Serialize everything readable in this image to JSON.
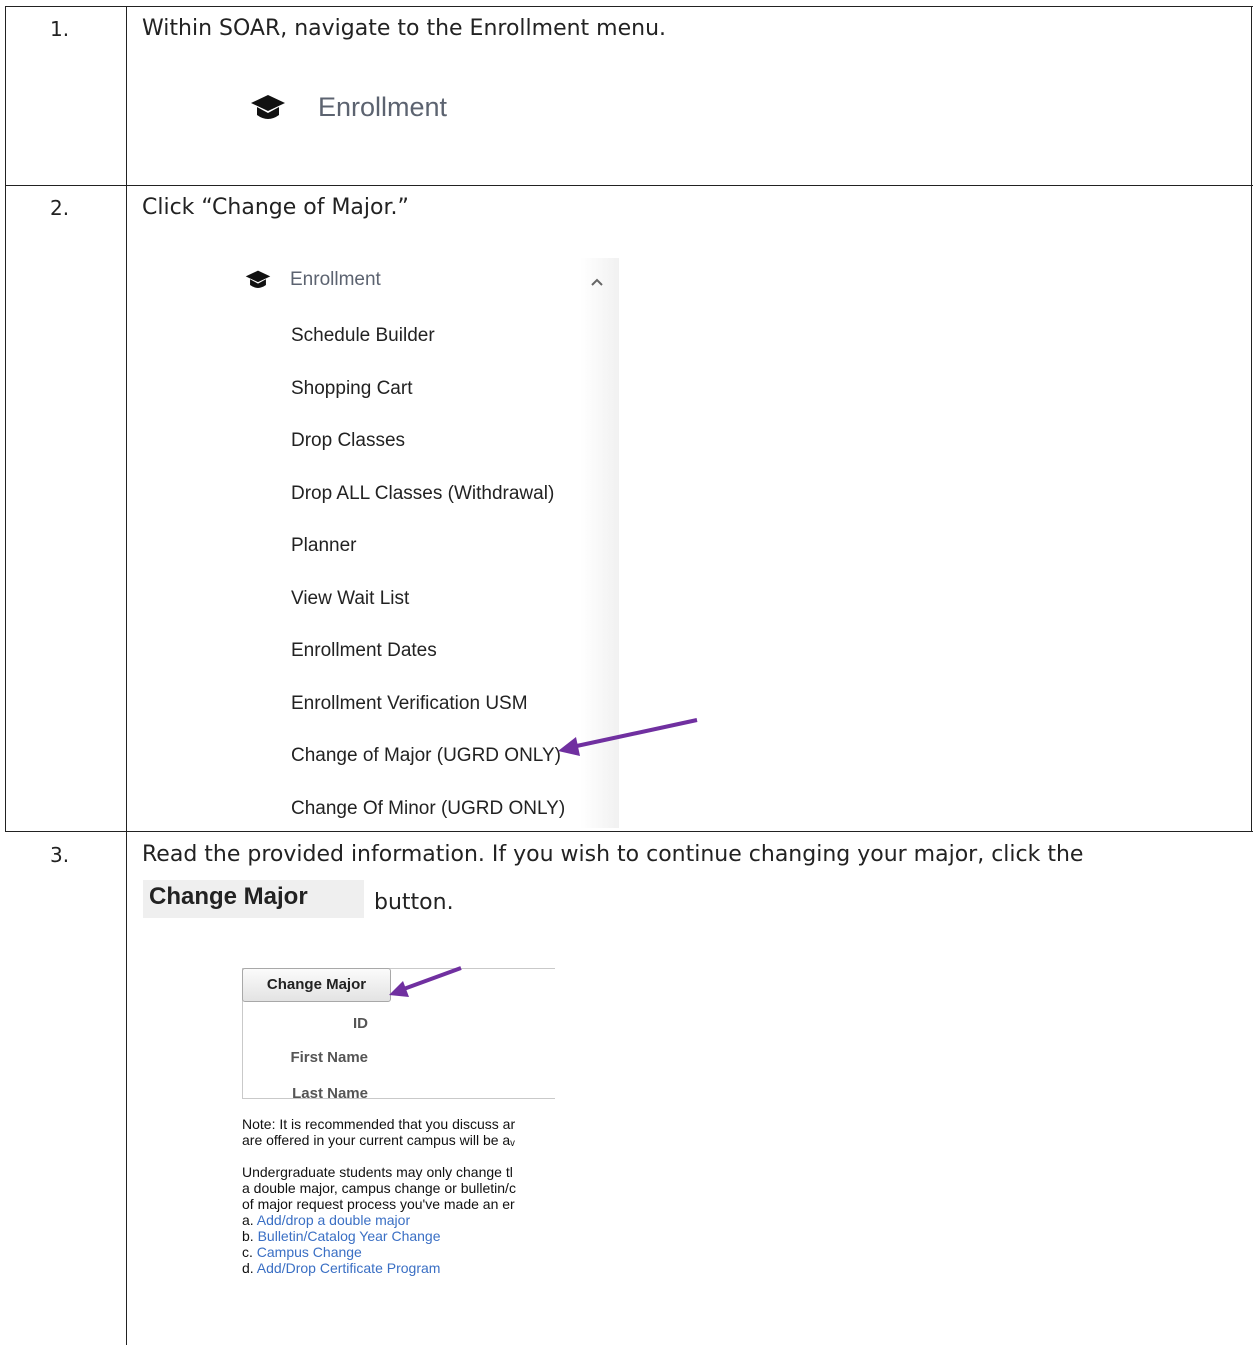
{
  "steps": [
    {
      "number": "1.",
      "text": "Within SOAR, navigate to the Enrollment menu."
    },
    {
      "number": "2.",
      "text": "Click “Change of Major.”"
    },
    {
      "number": "3.",
      "text": "Read the provided information.  If you wish to continue changing your major, click the"
    }
  ],
  "step1": {
    "menu_label": "Enrollment",
    "icon": "graduation-cap-icon"
  },
  "step2": {
    "menu_header": "Enrollment",
    "items": [
      "Schedule Builder",
      "Shopping Cart",
      "Drop Classes",
      "Drop ALL Classes (Withdrawal)",
      "Planner",
      "View Wait List",
      "Enrollment Dates",
      "Enrollment Verification USM",
      "Change of Major (UGRD ONLY)",
      "Change Of Minor (UGRD ONLY)"
    ],
    "arrow_color": "#7030a0"
  },
  "step3": {
    "inline_button": "Change Major",
    "after_button": "button.",
    "form_button": "Change Major",
    "fields": [
      "ID",
      "First Name",
      "Last Name"
    ],
    "note_lines": [
      "Note: It is recommended that you discuss ar",
      "are offered in your current campus will be aᵥ"
    ],
    "para_lines": [
      "Undergraduate students may only change tl",
      "a double major, campus change or bulletin/c",
      "of major request process you've made an er"
    ],
    "links": [
      {
        "prefix": "a. ",
        "text": "Add/drop a double major"
      },
      {
        "prefix": "b. ",
        "text": "Bulletin/Catalog Year Change"
      },
      {
        "prefix": "c. ",
        "text": "Campus Change"
      },
      {
        "prefix": "d. ",
        "text": "Add/Drop Certificate Program"
      }
    ],
    "link_color": "#3a6fc4"
  }
}
